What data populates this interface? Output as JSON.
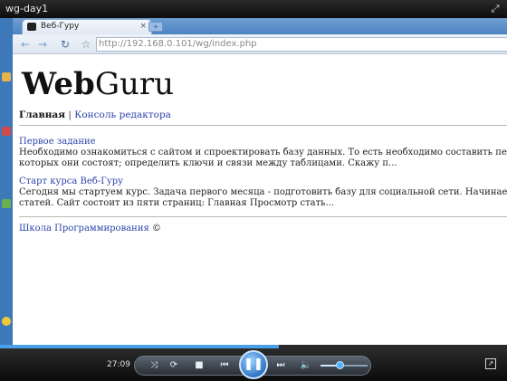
{
  "player": {
    "window_title": "wg-day1",
    "time": "27:09",
    "progress": 0.55,
    "volume": 0.4,
    "icons": {
      "fullscreen": "fullscreen-toggle-icon",
      "switch_view": "switch-view-icon",
      "shuffle": "shuffle-icon",
      "repeat": "repeat-icon",
      "stop": "stop-icon",
      "previous": "previous-icon",
      "play_pause": "pause-icon",
      "next": "next-icon",
      "mute": "speaker-icon"
    }
  },
  "browser": {
    "tab": {
      "title": "Веб-Гуру",
      "close": "×",
      "new_tab": "+"
    },
    "url": "http://192.168.0.101/wg/index.php"
  },
  "page": {
    "logo": {
      "bold": "Web",
      "regular": "Guru"
    },
    "nav": {
      "home": "Главная",
      "separator": "|",
      "console": "Консоль редактора"
    },
    "articles": [
      {
        "title": "Первое задание",
        "line1": "Необходимо ознакомиться с сайтом и спроектировать базу данных. То есть необходимо составить перечень таблиц",
        "line2": "которых они состоят; определить ключи и связи между таблицами. Скажу п..."
      },
      {
        "title": "Старт курса Веб-Гуру",
        "line1": "Сегодня мы стартуем курс. Задача первого месяца - подготовить базу для социальной сети. Начинаем с простого: п",
        "line2": "статей. Сайт состоит из пяти страниц: Главная Просмотр стать..."
      }
    ],
    "footer": {
      "link": "Школа Программирования",
      "copyright": "©"
    }
  },
  "colors": {
    "link": "#2c44a8",
    "accent": "#4aa0e8"
  }
}
